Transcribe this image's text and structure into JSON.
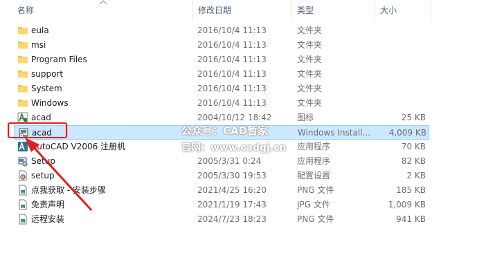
{
  "columns": {
    "name": "名称",
    "date": "修改日期",
    "type": "类型",
    "size": "大小"
  },
  "rows": [
    {
      "icon": "folder-icon",
      "name": "eula",
      "date": "2016/10/4 11:13",
      "type": "文件夹",
      "size": ""
    },
    {
      "icon": "folder-icon",
      "name": "msi",
      "date": "2016/10/4 11:13",
      "type": "文件夹",
      "size": ""
    },
    {
      "icon": "folder-icon",
      "name": "Program Files",
      "date": "2016/10/4 11:13",
      "type": "文件夹",
      "size": ""
    },
    {
      "icon": "folder-icon",
      "name": "support",
      "date": "2016/10/4 11:13",
      "type": "文件夹",
      "size": ""
    },
    {
      "icon": "folder-icon",
      "name": "System",
      "date": "2016/10/4 11:13",
      "type": "文件夹",
      "size": ""
    },
    {
      "icon": "folder-icon",
      "name": "Windows",
      "date": "2016/10/4 11:13",
      "type": "文件夹",
      "size": ""
    },
    {
      "icon": "autocad-icon",
      "name": "acad",
      "date": "2004/10/12 18:42",
      "type": "图标",
      "size": "25 KB"
    },
    {
      "icon": "installer-icon",
      "name": "acad",
      "date": "",
      "type": "Windows Install...",
      "size": "4,009 KB"
    },
    {
      "icon": "autocad-app-icon",
      "name": "AutoCAD V2006 注册机",
      "date": "",
      "type": "应用程序",
      "size": "70 KB"
    },
    {
      "icon": "setup-icon",
      "name": "Setup",
      "date": "2005/3/31 0:24",
      "type": "应用程序",
      "size": "82 KB"
    },
    {
      "icon": "config-icon",
      "name": "setup",
      "date": "2005/3/30 19:53",
      "type": "配置设置",
      "size": "2 KB"
    },
    {
      "icon": "image-file-icon",
      "name": "点我获取 - 安装步骤",
      "date": "2021/4/25 16:20",
      "type": "PNG 文件",
      "size": "185 KB"
    },
    {
      "icon": "image-file-icon",
      "name": "免责声明",
      "date": "2021/1/19 17:43",
      "type": "JPG 文件",
      "size": "1,009 KB"
    },
    {
      "icon": "image-file-icon",
      "name": "远程安装",
      "date": "2024/7/23 18:23",
      "type": "PNG 文件",
      "size": "941 KB"
    }
  ],
  "selected_row": 7,
  "watermark": {
    "line1": "公众号：CAD暂家",
    "line2": "官网：www.cadgj.cn"
  },
  "colors": {
    "selection": "#cce8ff",
    "highlight": "#e02020",
    "folder": "#f2c14e"
  }
}
